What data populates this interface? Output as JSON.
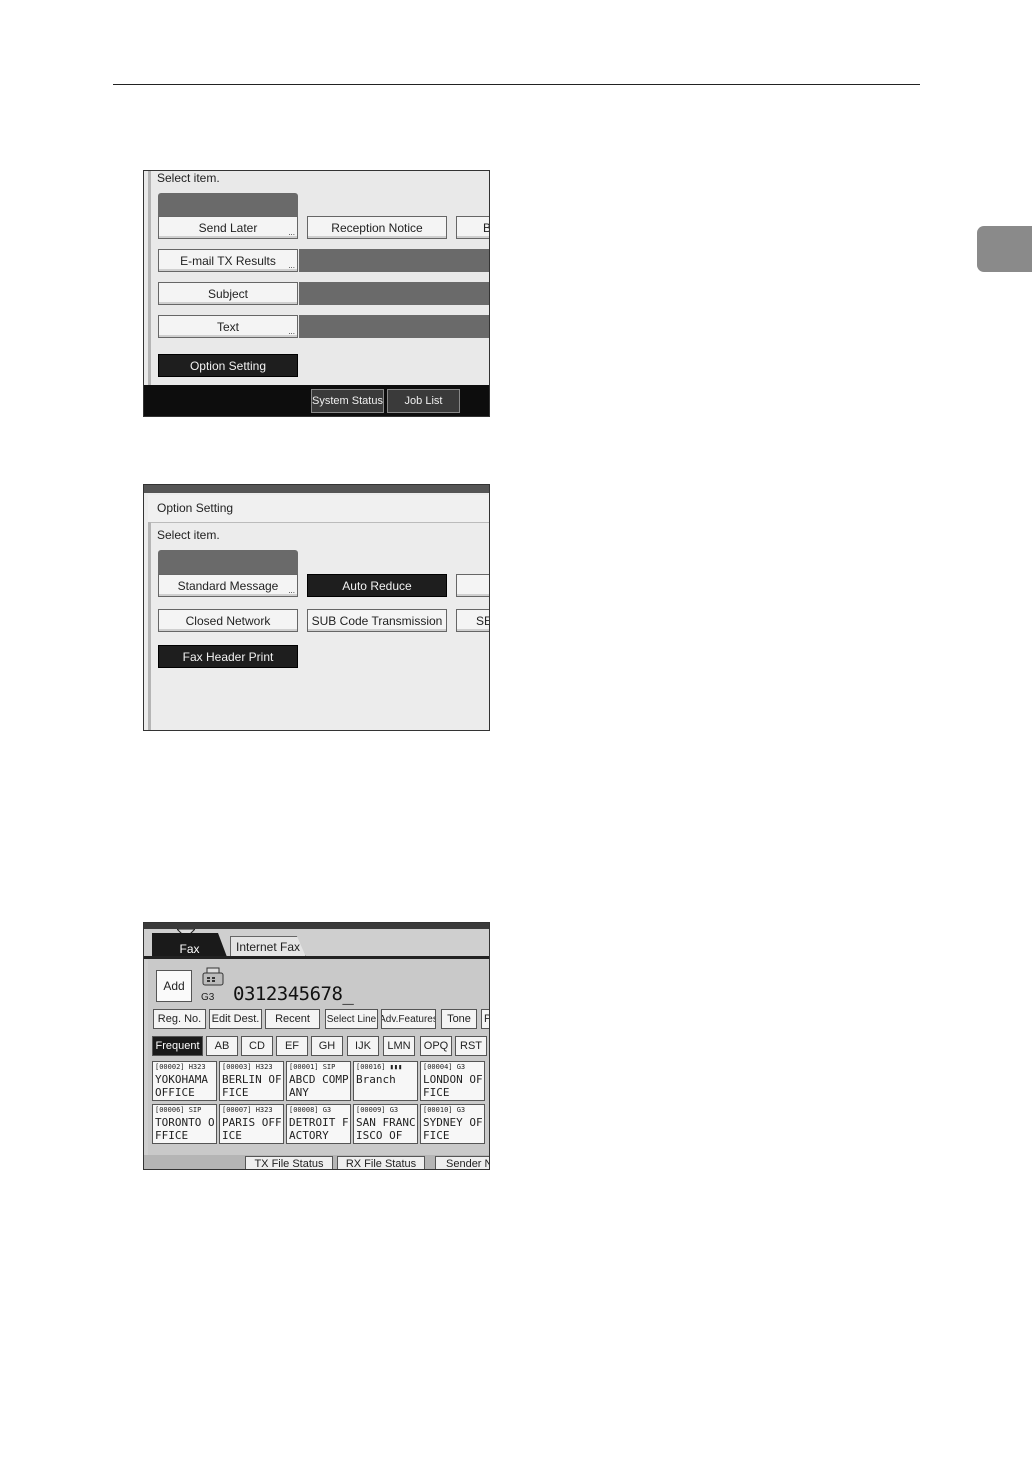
{
  "screen1": {
    "prompt": "Select item.",
    "buttons": {
      "send_later": "Send Later",
      "reception_notice": "Reception Notice",
      "cut_off_partial": "B",
      "email_tx_results": "E-mail TX Results",
      "subject": "Subject",
      "text": "Text",
      "option_setting": "Option Setting"
    },
    "footer": {
      "system_status": "System Status",
      "job_list": "Job List"
    }
  },
  "screen2": {
    "title": "Option Setting",
    "prompt": "Select item.",
    "buttons": {
      "standard_message": "Standard Message",
      "auto_reduce": "Auto Reduce",
      "closed_network": "Closed Network",
      "sub_code_transmission": "SUB Code Transmission",
      "cut_off_partial": "SE",
      "fax_header_print": "Fax Header Print"
    }
  },
  "screen3": {
    "tabs": {
      "fax": "Fax",
      "internet_fax": "Internet Fax"
    },
    "add_button": "Add",
    "line_type": "G3",
    "destination_number": "0312345678_",
    "toolbar": {
      "reg_no": "Reg. No.",
      "edit_dest": "Edit Dest.",
      "recent": "Recent",
      "select_line": "Select Line",
      "adv_features": "Adv.Features",
      "tone": "Tone",
      "cut_off_partial": "P"
    },
    "index_tabs": [
      "Frequent",
      "AB",
      "CD",
      "EF",
      "GH",
      "IJK",
      "LMN",
      "OPQ",
      "RST"
    ],
    "destinations": [
      {
        "code": "[00002] H323",
        "name": "YOKOHAMA OFFICE"
      },
      {
        "code": "[00003] H323",
        "name": "BERLIN OFFICE"
      },
      {
        "code": "[00001] SIP",
        "name": "ABCD COMPANY"
      },
      {
        "code": "[00016] ▮▮▮",
        "name": "Branch"
      },
      {
        "code": "[00004] G3",
        "name": "LONDON OFFICE"
      },
      {
        "code": "[00006] SIP",
        "name": "TORONTO OFFICE"
      },
      {
        "code": "[00007] H323",
        "name": "PARIS OFFICE"
      },
      {
        "code": "[00008] G3",
        "name": "DETROIT FACTORY"
      },
      {
        "code": "[00009] G3",
        "name": "SAN FRANCISCO OF"
      },
      {
        "code": "[00010] G3",
        "name": "SYDNEY OFFICE"
      }
    ],
    "footer": {
      "tx_file_status": "TX File Status",
      "rx_file_status": "RX File Status",
      "sender_partial": "Sender N"
    }
  }
}
